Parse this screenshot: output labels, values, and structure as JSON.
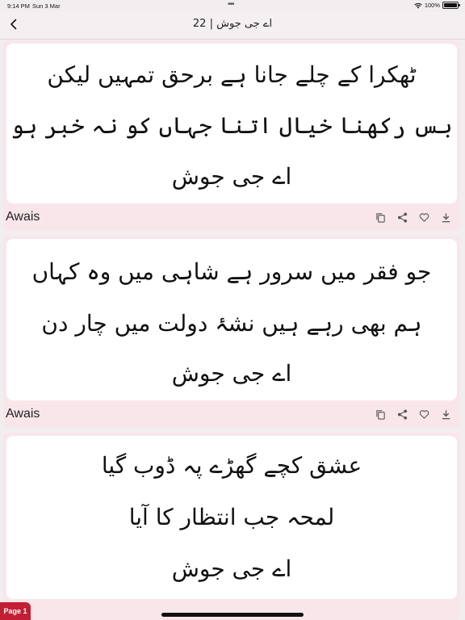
{
  "status_bar": {
    "time": "9:14 PM",
    "date": "Sun 3 Mar",
    "dots": "•••",
    "battery": "100%"
  },
  "nav": {
    "title": "اے جی جوش | 22",
    "back_icon": "chevron-left-icon"
  },
  "cards": [
    {
      "lines": [
        "ٹھکرا کے چلے جانا ہے برحق تمہیں لیکن",
        "بس رکھنا خیال اتنا جہاں کو نہ خبر ہو",
        "اے جی جوش"
      ],
      "author": "Awais"
    },
    {
      "lines": [
        "جو فقر میں سرور ہے شاہی میں وہ کہاں",
        "ہم بھی رہے ہیں نشۂ دولت میں چار دن",
        "اے جی جوش"
      ],
      "author": "Awais"
    },
    {
      "lines": [
        "عشق کچے گھڑے پہ ڈوب گیا",
        "لمحہ جب انتظار کا آیا",
        "اے جی جوش"
      ],
      "author": ""
    }
  ],
  "actions": {
    "icons": [
      "copy-icon",
      "share-icon",
      "heart-icon",
      "download-icon"
    ]
  },
  "page_badge": "Page 1",
  "colors": {
    "card_bg": "#f9e6eb",
    "badge": "#c21f34"
  }
}
